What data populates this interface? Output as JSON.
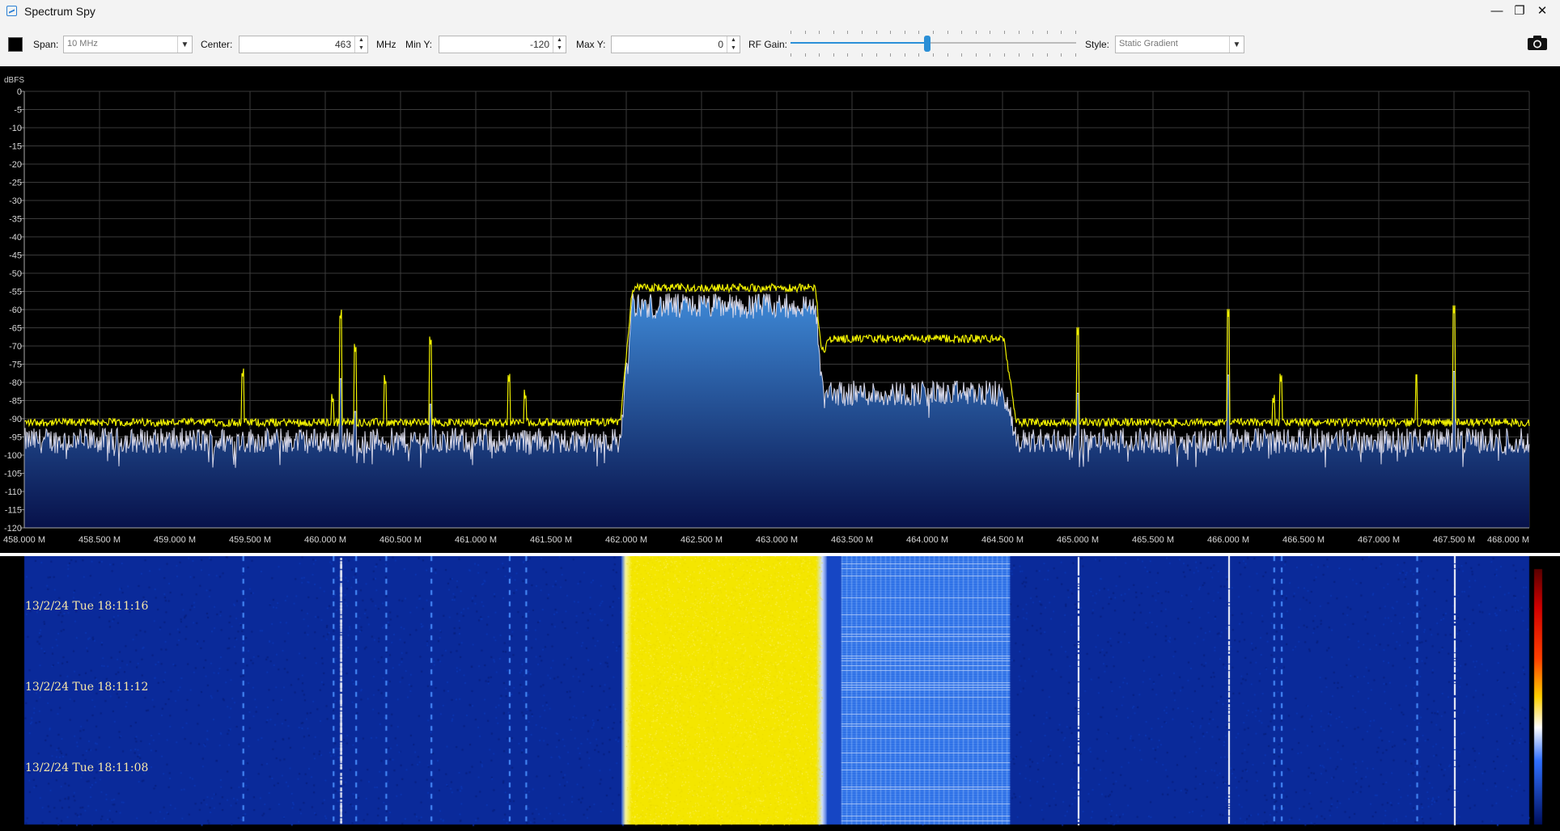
{
  "window": {
    "title": "Spectrum Spy",
    "minimize": "—",
    "maximize": "❐",
    "close": "✕"
  },
  "toolbar": {
    "span_label": "Span:",
    "span_value": "10 MHz",
    "center_label": "Center:",
    "center_value": "463",
    "center_unit": "MHz",
    "miny_label": "Min Y:",
    "miny_value": "-120",
    "maxy_label": "Max Y:",
    "maxy_value": "0",
    "rfgain_label": "RF Gain:",
    "rfgain_fraction": 0.48,
    "style_label": "Style:",
    "style_value": "Static Gradient"
  },
  "colors": {
    "background": "#000000",
    "grid": "#3a3a3a",
    "max_hold_trace": "#f0f000",
    "live_trace": "#d8d8e8",
    "fill_top": "#3f8ad8",
    "fill_bottom": "#07114a",
    "waterfall_bg": "#0a2a9a",
    "waterfall_hot": "#f4e600"
  },
  "icons": {
    "camera": "camera-icon",
    "app": "spectrum-icon"
  },
  "chart_data": {
    "type": "line",
    "ylabel": "dBFS",
    "ylim": [
      -120,
      0
    ],
    "y_ticks": [
      "0",
      "-5",
      "-10",
      "-15",
      "-20",
      "-25",
      "-30",
      "-35",
      "-40",
      "-45",
      "-50",
      "-55",
      "-60",
      "-65",
      "-70",
      "-75",
      "-80",
      "-85",
      "-90",
      "-95",
      "-100",
      "-105",
      "-110",
      "-115",
      "-120"
    ],
    "xlim": [
      458.0,
      468.0
    ],
    "x_ticks": [
      "458.000 M",
      "458.500 M",
      "459.000 M",
      "459.500 M",
      "460.000 M",
      "460.500 M",
      "461.000 M",
      "461.500 M",
      "462.000 M",
      "462.500 M",
      "463.000 M",
      "463.500 M",
      "464.000 M",
      "464.500 M",
      "465.000 M",
      "465.500 M",
      "466.000 M",
      "466.500 M",
      "467.000 M",
      "467.500 M",
      "468.000 M"
    ],
    "grid": true,
    "noise_floor_dbfs": -96,
    "max_hold_floor_dbfs": -91,
    "bands": [
      {
        "start": 462.0,
        "end": 463.3,
        "live_dbfs": -59,
        "max_dbfs": -54
      },
      {
        "start": 463.3,
        "end": 464.55,
        "live_dbfs": -83,
        "max_dbfs": -68
      }
    ],
    "spikes": [
      {
        "freq": 459.45,
        "max_dbfs": -79
      },
      {
        "freq": 460.05,
        "max_dbfs": -86
      },
      {
        "freq": 460.1,
        "max_dbfs": -63
      },
      {
        "freq": 460.2,
        "max_dbfs": -72
      },
      {
        "freq": 460.4,
        "max_dbfs": -81
      },
      {
        "freq": 460.7,
        "max_dbfs": -70
      },
      {
        "freq": 461.22,
        "max_dbfs": -80
      },
      {
        "freq": 461.33,
        "max_dbfs": -85
      },
      {
        "freq": 465.0,
        "max_dbfs": -67
      },
      {
        "freq": 466.0,
        "max_dbfs": -62
      },
      {
        "freq": 466.3,
        "max_dbfs": -86
      },
      {
        "freq": 466.35,
        "max_dbfs": -80
      },
      {
        "freq": 467.25,
        "max_dbfs": -79
      },
      {
        "freq": 467.5,
        "max_dbfs": -61
      }
    ]
  },
  "waterfall": {
    "timestamps": [
      "13/2/24 Tue 18:11:16",
      "13/2/24 Tue 18:11:12",
      "13/2/24 Tue 18:11:08"
    ]
  }
}
